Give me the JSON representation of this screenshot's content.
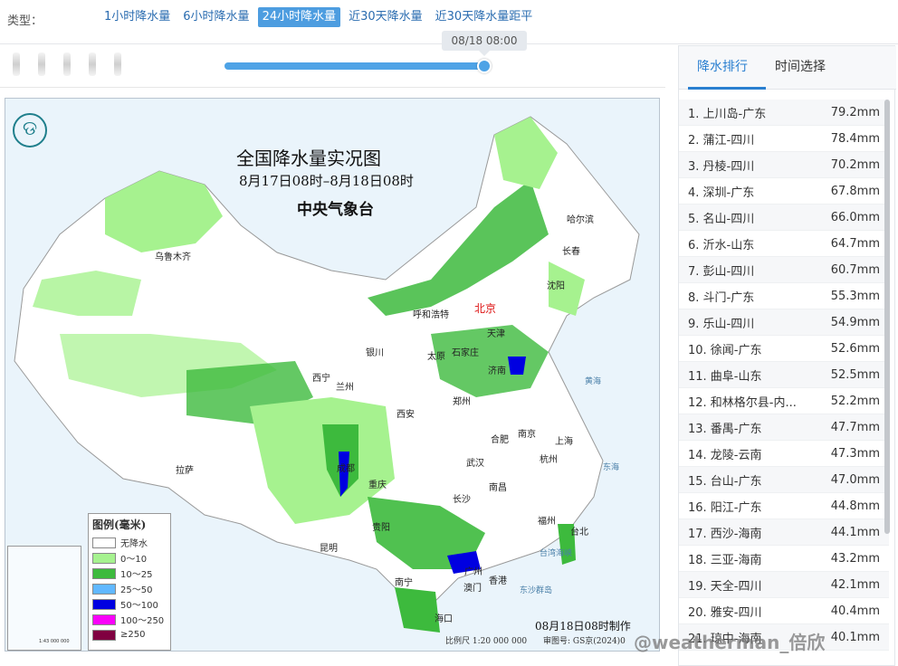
{
  "type_bar": {
    "label": "类型：",
    "tabs": [
      {
        "label": "1小时降水量",
        "active": false
      },
      {
        "label": "6小时降水量",
        "active": false
      },
      {
        "label": "24小时降水量",
        "active": true
      },
      {
        "label": "近30天降水量",
        "active": false
      },
      {
        "label": "近30天降水量距平",
        "active": false
      }
    ]
  },
  "timeline": {
    "current_time": "08/18 08:00",
    "progress_fraction": 0.99
  },
  "map": {
    "title": "全国降水量实况图",
    "subtitle": "8月17日08时–8月18日08时",
    "org": "中央气象台",
    "logo_glyph": "ଡ",
    "made_at": "08月18日08时制作",
    "scale": "比例尺 1:20 000 000",
    "review_no": "审图号: GS京(2024)0",
    "inset_scale": "1:43 000 000",
    "cities": [
      "乌鲁木齐",
      "哈尔滨",
      "长春",
      "沈阳",
      "北京",
      "呼和浩特",
      "天津",
      "石家庄",
      "太原",
      "银川",
      "济南",
      "西宁",
      "兰州",
      "郑州",
      "西安",
      "合肥",
      "南京",
      "上海",
      "武汉",
      "成都",
      "杭州",
      "重庆",
      "南昌",
      "长沙",
      "福州",
      "台北",
      "拉萨",
      "贵阳",
      "昆明",
      "南宁",
      "广州",
      "香港",
      "澳门",
      "海口"
    ],
    "capital_label": "北京",
    "seas": [
      "黄海",
      "东海",
      "台湾海峡",
      "东沙群岛"
    ],
    "legend": {
      "title": "图例(毫米)",
      "items": [
        {
          "label": "无降水",
          "color": "#ffffff"
        },
        {
          "label": "0～10",
          "color": "#a6f28f"
        },
        {
          "label": "10～25",
          "color": "#3dba3d"
        },
        {
          "label": "25～50",
          "color": "#61b8ff"
        },
        {
          "label": "50～100",
          "color": "#0000e1"
        },
        {
          "label": "100～250",
          "color": "#fa00fa"
        },
        {
          "label": "≥250",
          "color": "#800040"
        }
      ]
    }
  },
  "panel": {
    "tabs": [
      {
        "label": "降水排行",
        "active": true
      },
      {
        "label": "时间选择",
        "active": false
      }
    ],
    "ranking": [
      {
        "rank": "1.",
        "name": "上川岛-广东",
        "value": "79.2mm"
      },
      {
        "rank": "2.",
        "name": "蒲江-四川",
        "value": "78.4mm"
      },
      {
        "rank": "3.",
        "name": "丹棱-四川",
        "value": "70.2mm"
      },
      {
        "rank": "4.",
        "name": "深圳-广东",
        "value": "67.8mm"
      },
      {
        "rank": "5.",
        "name": "名山-四川",
        "value": "66.0mm"
      },
      {
        "rank": "6.",
        "name": "沂水-山东",
        "value": "64.7mm"
      },
      {
        "rank": "7.",
        "name": "彭山-四川",
        "value": "60.7mm"
      },
      {
        "rank": "8.",
        "name": "斗门-广东",
        "value": "55.3mm"
      },
      {
        "rank": "9.",
        "name": "乐山-四川",
        "value": "54.9mm"
      },
      {
        "rank": "10.",
        "name": "徐闻-广东",
        "value": "52.6mm"
      },
      {
        "rank": "11.",
        "name": "曲阜-山东",
        "value": "52.5mm"
      },
      {
        "rank": "12.",
        "name": "和林格尔县-内...",
        "value": "52.2mm"
      },
      {
        "rank": "13.",
        "name": "番禺-广东",
        "value": "47.7mm"
      },
      {
        "rank": "14.",
        "name": "龙陵-云南",
        "value": "47.3mm"
      },
      {
        "rank": "15.",
        "name": "台山-广东",
        "value": "47.0mm"
      },
      {
        "rank": "16.",
        "name": "阳江-广东",
        "value": "44.8mm"
      },
      {
        "rank": "17.",
        "name": "西沙-海南",
        "value": "44.1mm"
      },
      {
        "rank": "18.",
        "name": "三亚-海南",
        "value": "43.2mm"
      },
      {
        "rank": "19.",
        "name": "天全-四川",
        "value": "42.1mm"
      },
      {
        "rank": "20.",
        "name": "雅安-四川",
        "value": "40.4mm"
      },
      {
        "rank": "21.",
        "name": "琼中-海南",
        "value": "40.1mm"
      }
    ]
  },
  "watermark": "@weatherman_倍欣"
}
